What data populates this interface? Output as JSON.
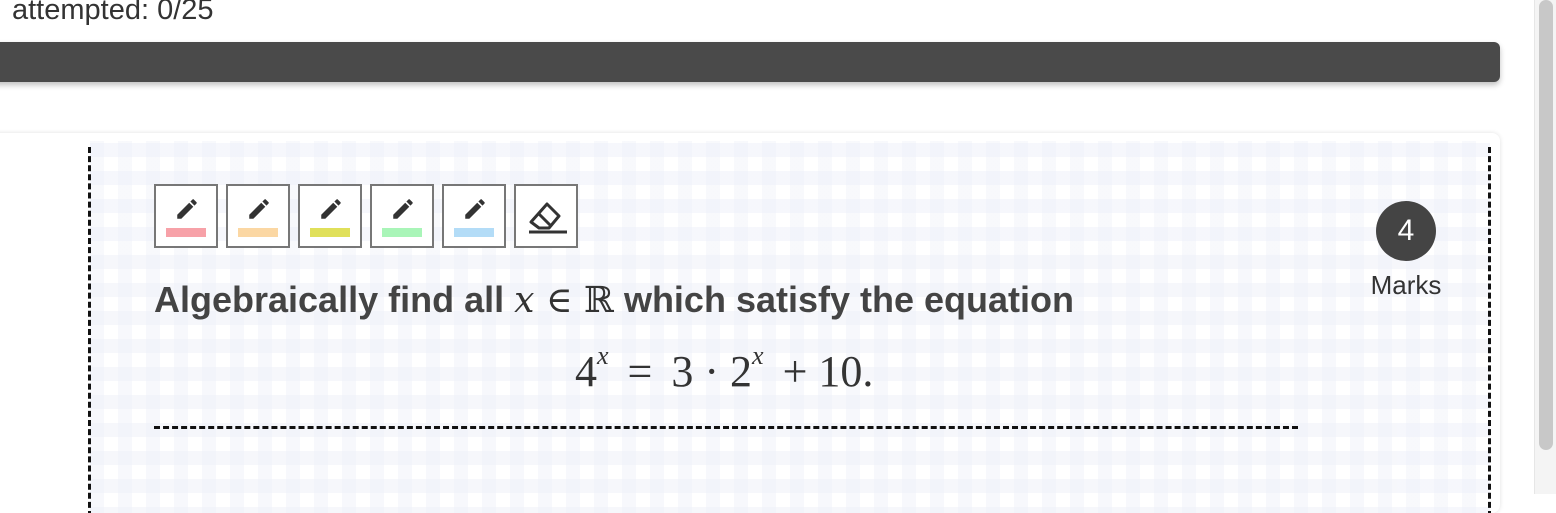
{
  "progress": {
    "attempted_text": "attempted: 0/25",
    "fraction": 0
  },
  "toolbar": {
    "tools": [
      {
        "icon": "pencil-icon",
        "color": "#f7a1a8"
      },
      {
        "icon": "pencil-icon",
        "color": "#fbd7a3"
      },
      {
        "icon": "pencil-icon",
        "color": "#e0e05a"
      },
      {
        "icon": "pencil-icon",
        "color": "#a9f5b8"
      },
      {
        "icon": "pencil-icon",
        "color": "#b3dcf7"
      },
      {
        "icon": "eraser-icon",
        "color": ""
      }
    ]
  },
  "question": {
    "prefix": "Algebraically find all",
    "var": "x",
    "in_symbol": "∈",
    "set": "ℝ",
    "suffix": "which satisfy the equation",
    "equation": {
      "base1": "4",
      "exp1": "x",
      "equals": "=",
      "coeff": "3 · 2",
      "exp2": "x",
      "tail": "+ 10."
    }
  },
  "marks": {
    "value": "4",
    "label": "Marks"
  }
}
